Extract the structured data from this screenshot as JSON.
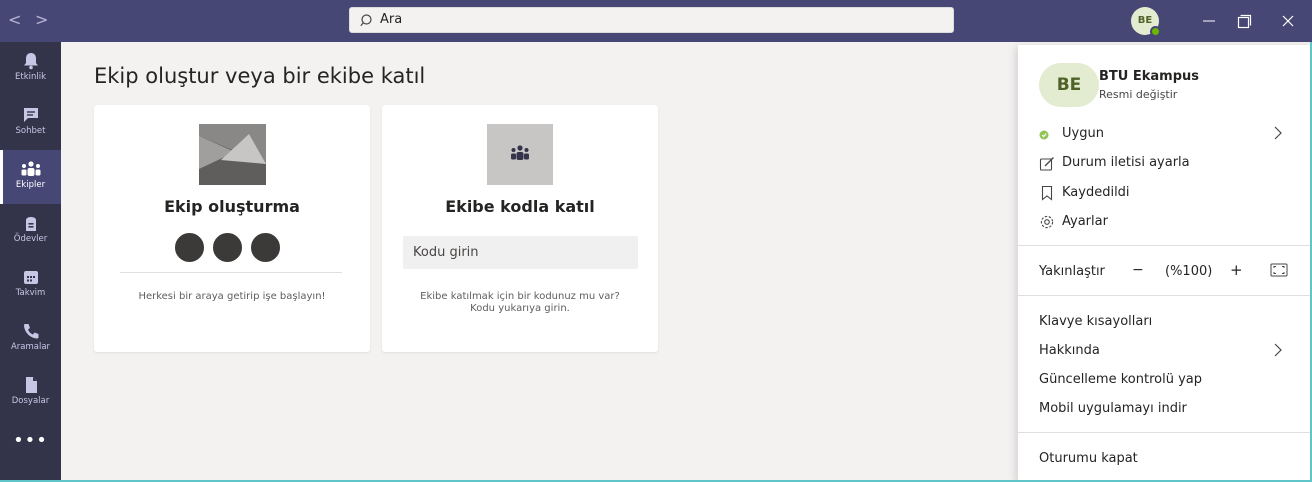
{
  "titlebar": {
    "back_label": "<",
    "forward_label": ">",
    "search_placeholder": "Ara",
    "avatar_initials": "BE"
  },
  "rail": {
    "items": [
      {
        "label": "Etkinlik",
        "icon": "bell-icon"
      },
      {
        "label": "Sohbet",
        "icon": "chat-icon"
      },
      {
        "label": "Ekipler",
        "icon": "teams-icon",
        "active": true
      },
      {
        "label": "Ödevler",
        "icon": "assignments-icon"
      },
      {
        "label": "Takvim",
        "icon": "calendar-icon"
      },
      {
        "label": "Aramalar",
        "icon": "phone-icon"
      },
      {
        "label": "Dosyalar",
        "icon": "file-icon"
      }
    ],
    "more_label": "•••"
  },
  "main": {
    "title": "Ekip oluştur veya bir ekibe katıl",
    "create_card": {
      "title": "Ekip oluşturma",
      "description": "Herkesi bir araya getirip işe başlayın!"
    },
    "join_card": {
      "title": "Ekibe kodla katıl",
      "code_placeholder": "Kodu girin",
      "description_line1": "Ekibe katılmak için bir kodunuz mu var?",
      "description_line2": "Kodu yukarıya girin."
    }
  },
  "profile_menu": {
    "avatar_initials": "BE",
    "user_name": "BTU Ekampus",
    "change_picture": "Resmi değiştir",
    "status": "Uygun",
    "status_message": "Durum iletisi ayarla",
    "saved": "Kaydedildi",
    "settings": "Ayarlar",
    "zoom_label": "Yakınlaştır",
    "zoom_minus": "−",
    "zoom_value": "(%100)",
    "zoom_plus": "+",
    "keyboard_shortcuts": "Klavye kısayolları",
    "about": "Hakkında",
    "check_updates": "Güncelleme kontrolü yap",
    "download_mobile": "Mobil uygulamayı indir",
    "sign_out": "Oturumu kapat"
  },
  "colors": {
    "titlebar": "#464775",
    "rail": "#33344a",
    "status_available": "#6bb700",
    "avatar_bg": "#e3ecd0"
  }
}
